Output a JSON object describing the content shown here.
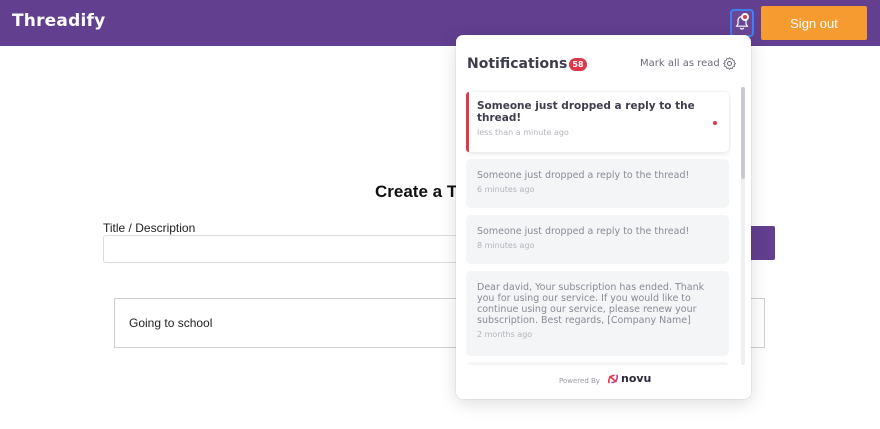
{
  "navbar": {
    "brand": "Threadify",
    "signout_label": "Sign out"
  },
  "page": {
    "heading": "Create a T",
    "field_label": "Title / Description",
    "thread_title": "Going to school"
  },
  "notifications": {
    "title": "Notifications",
    "count": "58",
    "mark_all_label": "Mark all as read",
    "items": [
      {
        "text": "Someone just dropped a reply to the thread!",
        "time": "less than a minute ago",
        "unread": true
      },
      {
        "text": "Someone just dropped a reply to the thread!",
        "time": "6 minutes ago",
        "unread": false
      },
      {
        "text": "Someone just dropped a reply to the thread!",
        "time": "8 minutes ago",
        "unread": false
      },
      {
        "text": "Dear david, Your subscription has ended. Thank you for using our service. If you would like to continue using our service, please renew your subscription. Best regards, [Company Name]",
        "time": "2 months ago",
        "unread": false
      }
    ],
    "powered_by": "Powered By",
    "powered_brand": "novu"
  },
  "colors": {
    "navbar": "#623f8f",
    "signout": "#f59b30",
    "badge": "#e0364a"
  },
  "icons": {
    "bell": "bell-icon",
    "settings": "gear-icon",
    "logo": "novu-logo-icon"
  }
}
